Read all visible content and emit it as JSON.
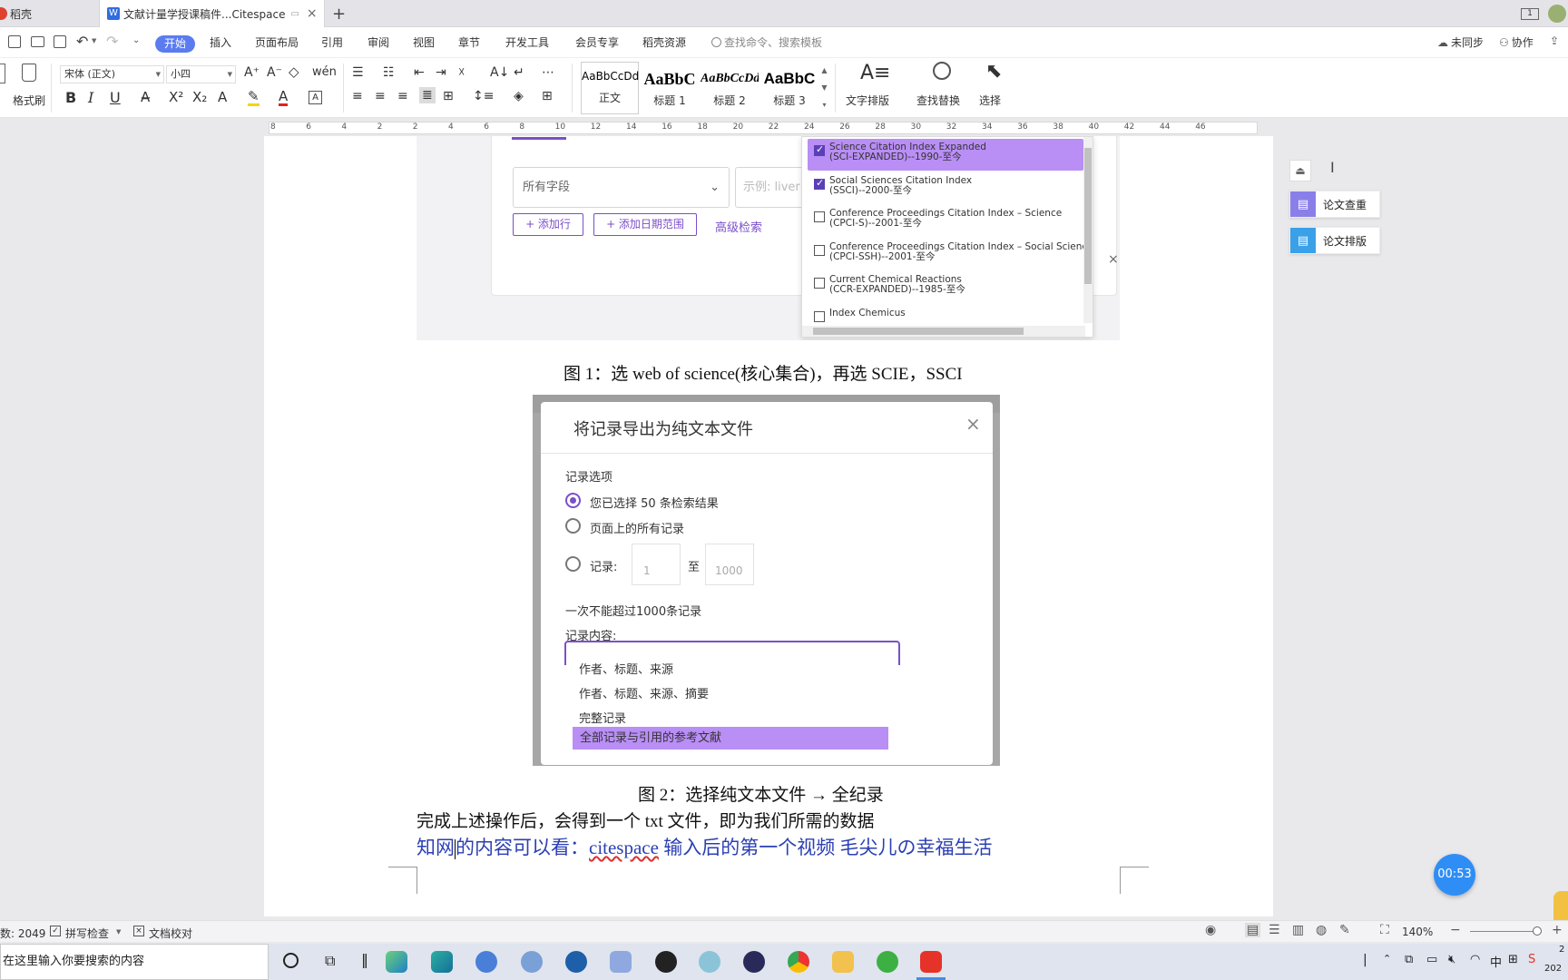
{
  "tabs": {
    "home_label": "稻壳",
    "doc_label": "文献计量学授课稿件...Citespace",
    "new_tab": "+",
    "page_count": "1"
  },
  "menubar": {
    "items": [
      "开始",
      "插入",
      "页面布局",
      "引用",
      "审阅",
      "视图",
      "章节",
      "开发工具",
      "会员专享",
      "稻壳资源"
    ],
    "search_placeholder": "查找命令、搜索模板",
    "sync_label": "未同步",
    "collab_label": "协作"
  },
  "ribbon": {
    "format_painter": "格式刷",
    "font_name": "宋体 (正文)",
    "font_size": "小四",
    "styles": [
      {
        "preview": "AaBbCcDd",
        "label": "正文"
      },
      {
        "preview": "AaBbC",
        "label": "标题 1"
      },
      {
        "preview": "AaBbCcDd",
        "label": "标题 2"
      },
      {
        "preview": "AaBbC",
        "label": "标题 3"
      }
    ],
    "text_layout": "文字排版",
    "find_replace": "查找替换",
    "select": "选择"
  },
  "ruler": {
    "ticks": [
      "8",
      "6",
      "4",
      "2",
      "2",
      "4",
      "6",
      "8",
      "10",
      "12",
      "14",
      "16",
      "18",
      "20",
      "22",
      "24",
      "26",
      "28",
      "30",
      "32",
      "34",
      "36",
      "38",
      "40",
      "42",
      "44",
      "46"
    ]
  },
  "figure1": {
    "field_select": "所有字段",
    "example_placeholder": "示例: liver c",
    "add_row": "+ 添加行",
    "add_date_range": "+ 添加日期范围",
    "advanced_search": "高级检索",
    "indexes": [
      {
        "line1": "Science Citation Index Expanded",
        "line2": "(SCI-EXPANDED)--1990-至今",
        "checked": true,
        "highlight": true
      },
      {
        "line1": "Social Sciences Citation Index",
        "line2": "(SSCI)--2000-至今",
        "checked": true,
        "highlight": false
      },
      {
        "line1": "Conference Proceedings Citation Index – Science",
        "line2": "(CPCI-S)--2001-至今",
        "checked": false,
        "highlight": false
      },
      {
        "line1": "Conference Proceedings Citation Index – Social Science & H",
        "line2": "(CPCI-SSH)--2001-至今",
        "checked": false,
        "highlight": false
      },
      {
        "line1": "Current Chemical Reactions",
        "line2": "(CCR-EXPANDED)--1985-至今",
        "checked": false,
        "highlight": false
      },
      {
        "line1": "Index Chemicus",
        "line2": "",
        "checked": false,
        "highlight": false
      }
    ],
    "caption": "图 1：选 web of science(核心集合)，再选 SCIE，SSCI"
  },
  "figure2": {
    "dialog_title": "将记录导出为纯文本文件",
    "close": "×",
    "section_options": "记录选项",
    "option_selected": "您已选择 50 条检索结果",
    "option_all_page": "页面上的所有记录",
    "option_range": "记录:",
    "range_from": "1",
    "range_to_label": "至",
    "range_to": "1000",
    "limit_note": "一次不能超过1000条记录",
    "content_label": "记录内容:",
    "content_options": [
      "作者、标题、来源",
      "作者、标题、来源、摘要",
      "完整记录",
      "全部记录与引用的参考文献"
    ],
    "caption": "图 2：选择纯文本文件 → 全纪录"
  },
  "body_text": {
    "line1": "完成上述操作后，会得到一个 txt 文件，即为我们所需的数据",
    "line2_a": "知网",
    "line2_b": "的内容可以看：",
    "line2_c": "citespace",
    "line2_d": " 输入后的第一个视频  毛尖儿の幸福生活"
  },
  "side_panel": {
    "check_label": "论文查重",
    "layout_label": "论文排版"
  },
  "timer": "00:53",
  "statusbar": {
    "word_count": "数: 2049",
    "spell_check": "拼写检查",
    "proofread": "文档校对",
    "zoom": "140%"
  },
  "taskbar": {
    "search_placeholder": "在这里输入你要搜索的内容",
    "clock_a": "2",
    "clock_b": "202"
  }
}
